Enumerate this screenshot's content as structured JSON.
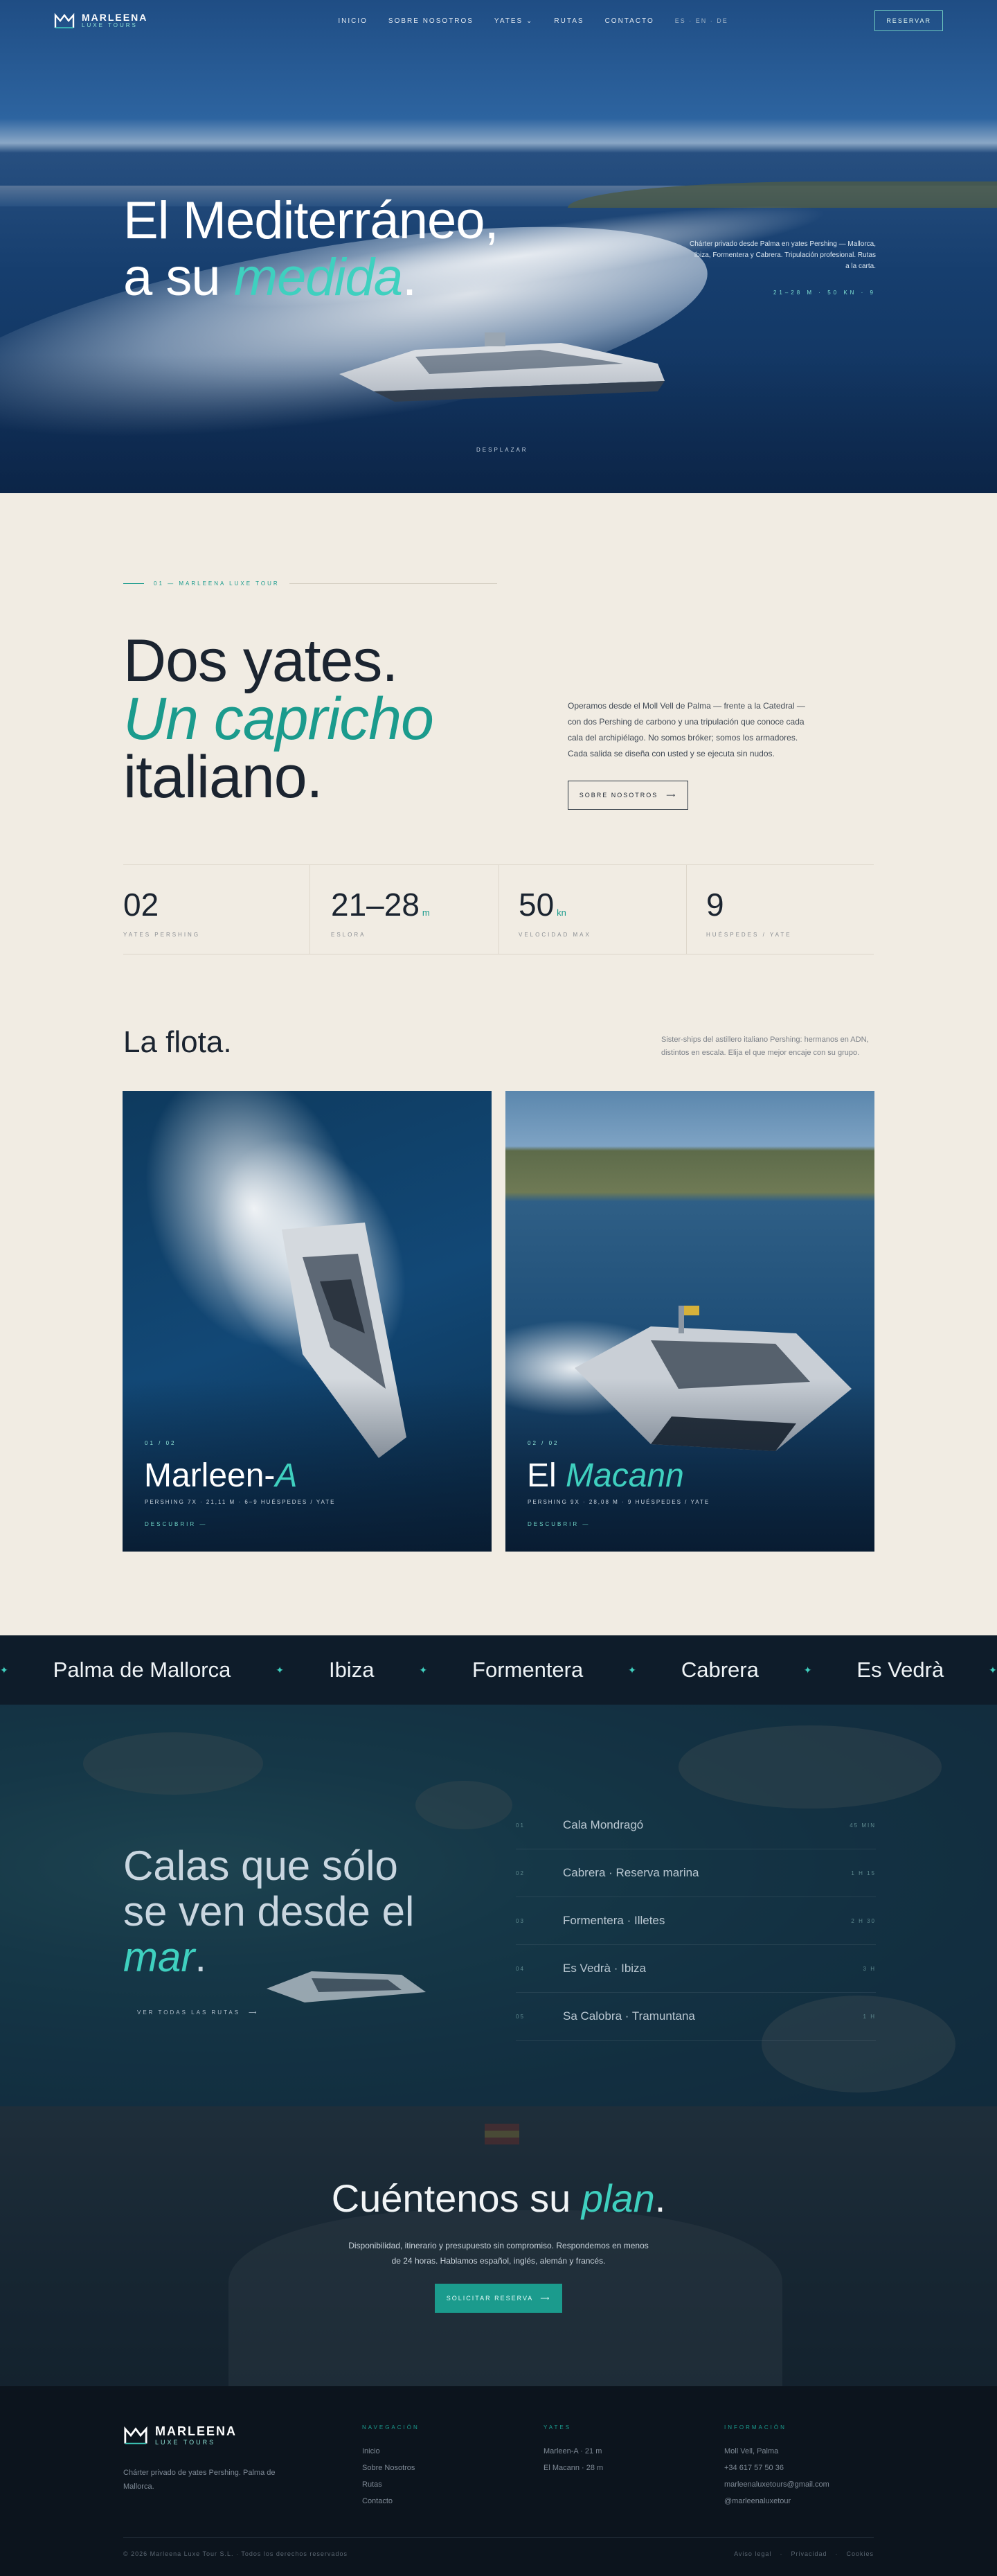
{
  "nav": {
    "logo_line1": "MARLEENA",
    "logo_line2": "LUXE TOURS",
    "items": [
      "INICIO",
      "SOBRE NOSOTROS",
      "YATES",
      "RUTAS",
      "CONTACTO"
    ],
    "lang": "ES · EN · DE",
    "reserve": "RESERVAR"
  },
  "hero": {
    "title_line1": "El Mediterráneo,",
    "title_line2_plain": "a su ",
    "title_line2_accent": "medida",
    "title_line2_end": ".",
    "side_text": "Chárter privado desde Palma en yates Pershing — Mallorca, Ibiza, Formentera y Cabrera. Tripulación profesional. Rutas a la carta.",
    "side_meta": "21–28 M · 50 KN · 9",
    "scroll": "DESPLAZAR"
  },
  "intro": {
    "eyebrow": "01 — MARLEENA LUXE TOUR",
    "h_line1": "Dos yates.",
    "h_line2": "Un capricho",
    "h_line3": "italiano.",
    "desc": "Operamos desde el Moll Vell de Palma — frente a la Catedral — con dos Pershing de carbono y una tripulación que conoce cada cala del archipiélago. No somos bróker; somos los armadores. Cada salida se diseña con usted y se ejecuta sin nudos.",
    "button": "SOBRE NOSOTROS",
    "stats": [
      {
        "value": "02",
        "unit": "",
        "label": "YATES PERSHING"
      },
      {
        "value": "21–28",
        "unit": "m",
        "label": "ESLORA"
      },
      {
        "value": "50",
        "unit": "kn",
        "label": "VELOCIDAD MAX"
      },
      {
        "value": "9",
        "unit": "",
        "label": "HUÉSPEDES / YATE"
      }
    ]
  },
  "fleet": {
    "title": "La flota.",
    "desc": "Sister-ships del astillero italiano Pershing: hermanos en ADN, distintos en escala. Elija el que mejor encaje con su grupo.",
    "cards": [
      {
        "num": "01 / 02",
        "name_plain": "Marleen-",
        "name_accent": "A",
        "spec": "PERSHING 7X   ·   21,11 M   ·   6–9 HUÉSPEDES / YATE",
        "more": "DESCUBRIR"
      },
      {
        "num": "02 / 02",
        "name_plain": "El ",
        "name_accent": "Macann",
        "spec": "PERSHING 9X   ·   28,08 M   ·   9 HUÉSPEDES / YATE",
        "more": "DESCUBRIR"
      }
    ]
  },
  "marquee": [
    "Palma de Mallorca",
    "Ibiza",
    "Formentera",
    "Cabrera",
    "Es Vedrà"
  ],
  "routes": {
    "h_line1": "Calas que sólo",
    "h_line2": "se ven desde el",
    "h_accent": "mar",
    "h_end": ".",
    "all": "VER TODAS LAS RUTAS",
    "items": [
      {
        "n": "01",
        "title": "Cala Mondragó",
        "d": "45 MIN"
      },
      {
        "n": "02",
        "title": "Cabrera · Reserva marina",
        "d": "1 H 15"
      },
      {
        "n": "03",
        "title": "Formentera · Illetes",
        "d": "2 H 30"
      },
      {
        "n": "04",
        "title": "Es Vedrà · Ibiza",
        "d": "3 H"
      },
      {
        "n": "05",
        "title": "Sa Calobra · Tramuntana",
        "d": "1 H"
      }
    ]
  },
  "cta": {
    "title_plain": "Cuéntenos su ",
    "title_accent": "plan",
    "title_end": ".",
    "text": "Disponibilidad, itinerario y presupuesto sin compromiso. Respondemos en menos de 24 horas. Hablamos español, inglés, alemán y francés.",
    "button": "SOLICITAR RESERVA"
  },
  "footer": {
    "logo_line1": "MARLEENA",
    "logo_line2": "LUXE TOURS",
    "tagline": "Chárter privado de yates Pershing. Palma de Mallorca.",
    "cols": [
      {
        "h": "NAVEGACIÓN",
        "items": [
          "Inicio",
          "Sobre Nosotros",
          "Rutas",
          "Contacto"
        ]
      },
      {
        "h": "YATES",
        "items": [
          "Marleen-A · 21 m",
          "El Macann · 28 m"
        ]
      },
      {
        "h": "INFORMACIÓN",
        "items": [
          "Moll Vell, Palma",
          "+34 617 57 50 36",
          "marleenaluxetours@gmail.com",
          "@marleenaluxetour"
        ]
      }
    ],
    "copyright": "© 2026 Marleena Luxe Tour S.L. · Todos los derechos reservados",
    "legal": [
      "Aviso legal",
      "Privacidad",
      "Cookies"
    ]
  },
  "colors": {
    "accent": "#1b9b8d",
    "accent_light": "#3fd0bf",
    "cream": "#f1ece3",
    "navy": "#0e1c2a"
  }
}
